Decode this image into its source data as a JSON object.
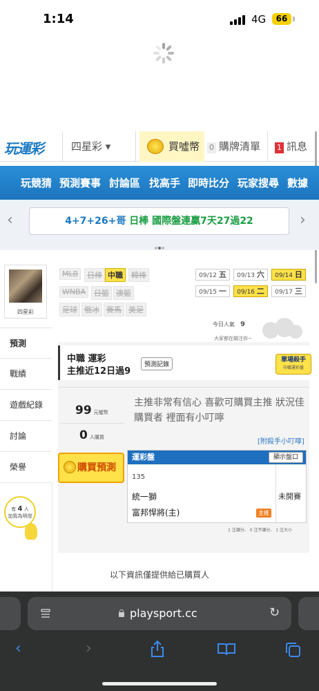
{
  "status_bar": {
    "time": "1:14",
    "network": "4G",
    "battery": "66"
  },
  "header": {
    "logo": "玩運彩",
    "game_select": "四星彩 ▾",
    "buy_coin": "買噓幣",
    "cart_count": "0",
    "cart_label": "購牌清單",
    "msg_count": "1",
    "msg_label": "訊息"
  },
  "nav": {
    "items": [
      "玩競猜",
      "預測賽事",
      "討論區",
      "找高手",
      "即時比分",
      "玩家搜尋",
      "數據"
    ]
  },
  "banner": {
    "text_a": "4+7+26+哥",
    "text_b": "日棒 國際盤連贏7天27過22"
  },
  "profile": {
    "name": "四星彩"
  },
  "sports": {
    "row1": [
      {
        "label": "MLB",
        "on": false
      },
      {
        "label": "日棒",
        "on": false
      },
      {
        "label": "中職",
        "on": true
      },
      {
        "label": "韓棒",
        "on": false
      }
    ],
    "row2": [
      {
        "label": "WNBA",
        "on": false
      },
      {
        "label": "日籃",
        "on": false
      },
      {
        "label": "澳籃",
        "on": false
      }
    ],
    "row3": [
      {
        "label": "足球",
        "on": false
      },
      {
        "label": "俄冰",
        "on": false
      },
      {
        "label": "賽馬",
        "on": false
      },
      {
        "label": "美足",
        "on": false
      }
    ]
  },
  "dates": [
    {
      "date": "09/12",
      "day": "五",
      "on": false
    },
    {
      "date": "09/13",
      "day": "六",
      "on": false
    },
    {
      "date": "09/14",
      "day": "日",
      "on": true
    },
    {
      "date": "09/15",
      "day": "一",
      "on": false
    },
    {
      "date": "09/16",
      "day": "二",
      "on": true
    },
    {
      "date": "09/17",
      "day": "三",
      "on": false
    }
  ],
  "popularity": {
    "label": "今日人氣",
    "value": "9",
    "watch": "大家都在關注你~"
  },
  "side_menu": [
    "預測",
    "戰績",
    "遊戲紀錄",
    "討論",
    "榮譽"
  ],
  "helper": {
    "prefix": "有",
    "count": "4",
    "suffix": "人",
    "line2": "加我為明燈"
  },
  "prediction": {
    "title1": "中職 運彩",
    "title2": "主推近12日過9",
    "record_btn": "預測記錄",
    "killer_title": "單場殺手",
    "killer_sub": "中職運彩盤",
    "coins": "99",
    "coins_unit": "元噓幣",
    "buyers": "0",
    "buyers_unit": "人購買",
    "note": "主推非常有信心 喜歡可購買主推 狀況佳 購買者 裡面有小叮嚀",
    "attach": "[附殺手小叮嚀]",
    "buy_btn": "購買預測",
    "table_head": "運彩盤",
    "show_odds": "顯示盤口",
    "game_no": "135",
    "team1": "統一獅",
    "team2": "富邦悍將(主)",
    "game_status": "未開賽",
    "host_tag": "主推",
    "legend": "1 注讓分、 0 注不讓分、 1 注大小"
  },
  "info_text": "以下資訊僅提供給已購買人",
  "browser": {
    "url": "playsport.cc"
  }
}
